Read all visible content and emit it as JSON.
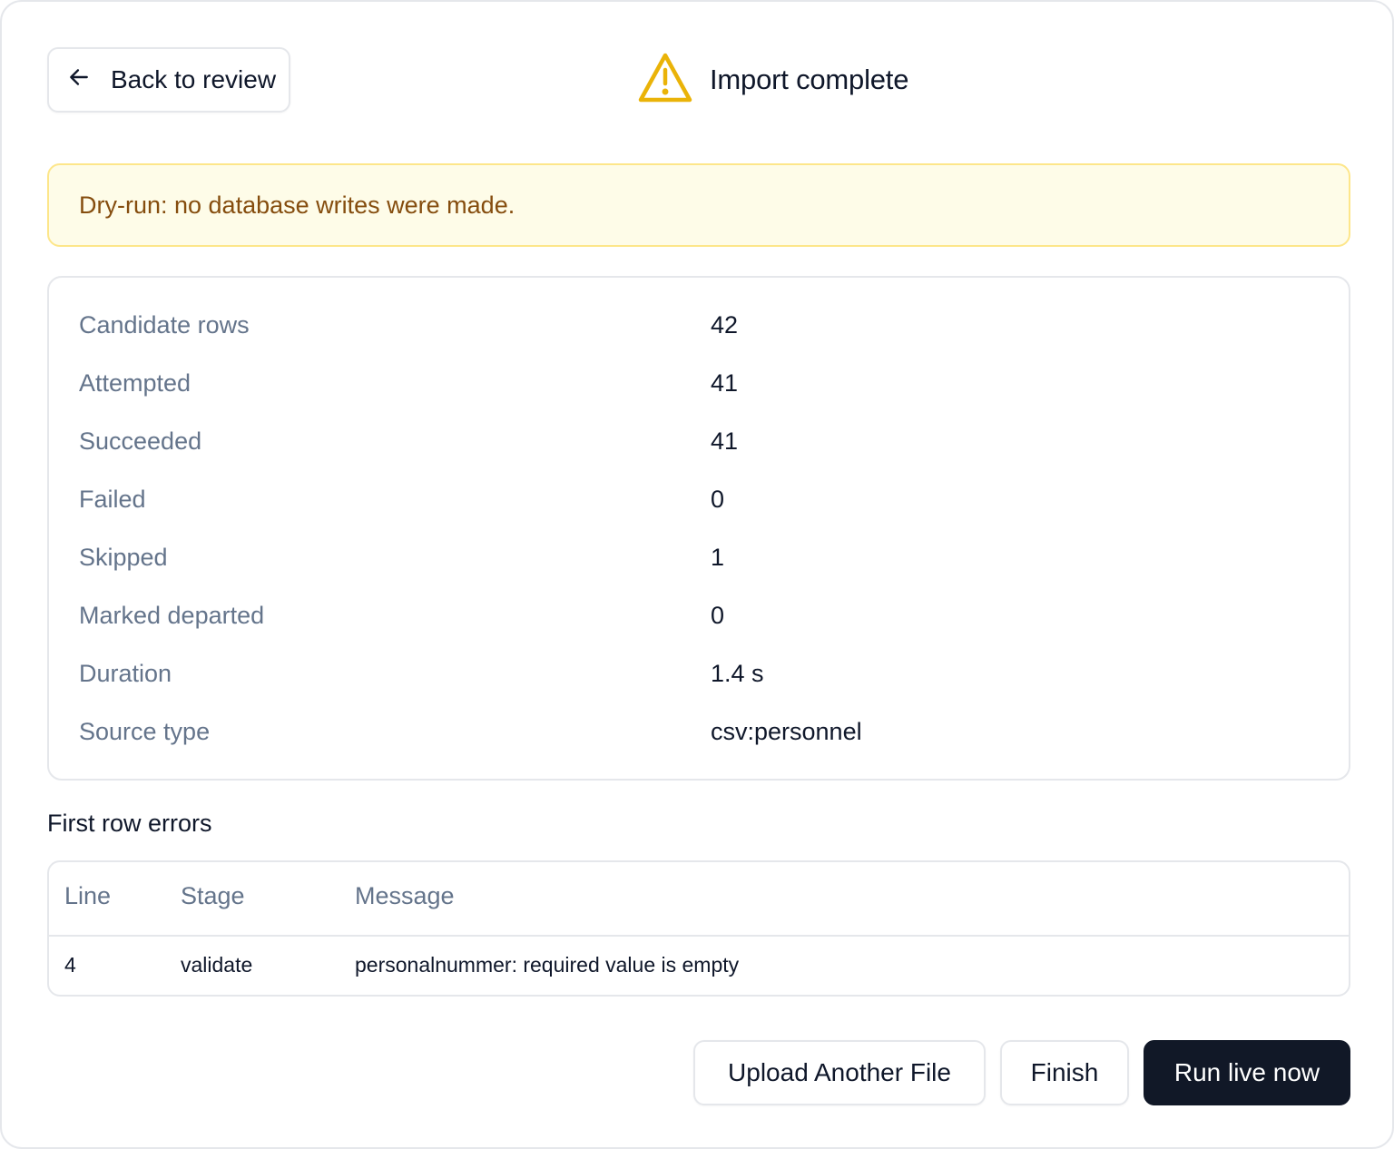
{
  "header": {
    "back_label": "Back to review",
    "title": "Import complete",
    "warning_color": "#eab308"
  },
  "banner": {
    "text": "Dry-run: no database writes were made."
  },
  "stats": [
    {
      "label": "Candidate rows",
      "value": "42"
    },
    {
      "label": "Attempted",
      "value": "41"
    },
    {
      "label": "Succeeded",
      "value": "41"
    },
    {
      "label": "Failed",
      "value": "0"
    },
    {
      "label": "Skipped",
      "value": "1"
    },
    {
      "label": "Marked departed",
      "value": "0"
    },
    {
      "label": "Duration",
      "value": "1.4 s"
    },
    {
      "label": "Source type",
      "value": "csv:personnel"
    }
  ],
  "errors": {
    "title": "First row errors",
    "columns": [
      "Line",
      "Stage",
      "Message"
    ],
    "rows": [
      {
        "line": "4",
        "stage": "validate",
        "message": "personalnummer: required value is empty"
      }
    ]
  },
  "actions": {
    "upload_label": "Upload Another File",
    "finish_label": "Finish",
    "live_label": "Run live now"
  }
}
